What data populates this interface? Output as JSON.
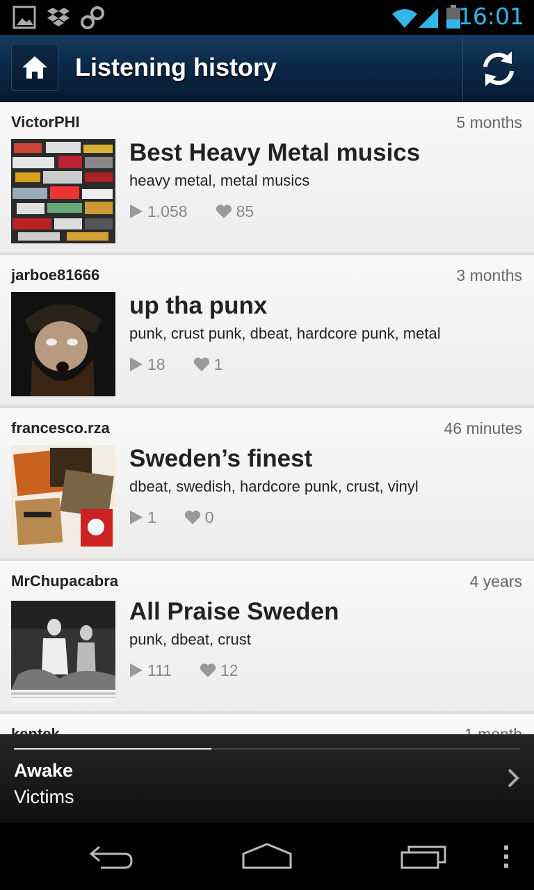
{
  "status_bar": {
    "time": "16:01",
    "icons": [
      "image-icon",
      "dropbox-icon",
      "infinity-icon",
      "wifi-icon",
      "signal-icon",
      "battery-icon"
    ]
  },
  "action_bar": {
    "title": "Listening history",
    "home_icon": "home-icon",
    "refresh_icon": "refresh-icon"
  },
  "items": [
    {
      "user": "VictorPHI",
      "time": "5 months",
      "title": "Best Heavy Metal musics",
      "tags": "heavy metal, metal musics",
      "plays": "1.058",
      "likes": "85"
    },
    {
      "user": "jarboe81666",
      "time": "3 months",
      "title": "up tha punx",
      "tags": "punk, crust punk, dbeat, hardcore punk, metal",
      "plays": "18",
      "likes": "1"
    },
    {
      "user": "francesco.rza",
      "time": "46 minutes",
      "title": "Sweden’s finest",
      "tags": "dbeat, swedish, hardcore punk, crust, vinyl",
      "plays": "1",
      "likes": "0"
    },
    {
      "user": "MrChupacabra",
      "time": "4 years",
      "title": "All Praise Sweden",
      "tags": "punk, dbeat, crust",
      "plays": "111",
      "likes": "12"
    },
    {
      "user": "kentek",
      "time": "1 month",
      "title": "",
      "tags": "",
      "plays": "",
      "likes": ""
    }
  ],
  "now_playing": {
    "title": "Awake",
    "artist": "Victims",
    "progress": 0.39
  },
  "nav": [
    "back-icon",
    "home-icon",
    "recent-apps-icon",
    "menu-icon"
  ]
}
